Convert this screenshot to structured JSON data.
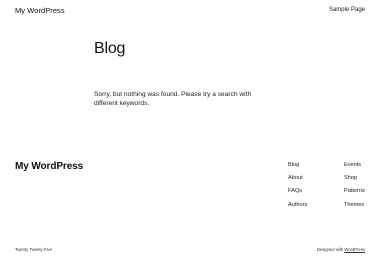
{
  "header": {
    "site_title": "My WordPress",
    "nav": [
      "Sample Page"
    ]
  },
  "main": {
    "page_title": "Blog",
    "message": "Sorry, but nothing was found. Please try a search with different keywords."
  },
  "footer": {
    "site_title": "My WordPress",
    "columns": [
      [
        "Blog",
        "About",
        "FAQs",
        "Authors"
      ],
      [
        "Events",
        "Shop",
        "Patterns",
        "Themes"
      ]
    ],
    "theme_credit": "Twenty Twenty-Five",
    "designed_with_prefix": "Designed with",
    "designed_with_link": "WordPress"
  }
}
